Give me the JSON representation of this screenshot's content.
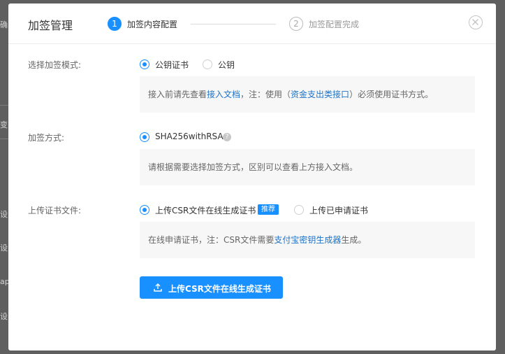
{
  "background": {
    "fragments": [
      "确",
      "变",
      "设",
      "设",
      "ap",
      "设"
    ]
  },
  "dialog": {
    "title": "加签管理",
    "steps": [
      {
        "number": "1",
        "label": "加签内容配置",
        "state": "active"
      },
      {
        "number": "2",
        "label": "加签配置完成",
        "state": "wait"
      }
    ]
  },
  "form": {
    "mode": {
      "label": "选择加签模式:",
      "options": [
        {
          "label": "公钥证书",
          "checked": true
        },
        {
          "label": "公钥",
          "checked": false
        }
      ],
      "hint": {
        "t1": "接入前请先查看",
        "link1": "接入文档",
        "t2": "，注：使用（",
        "link2": "资金支出类接口",
        "t3": "）必须使用证书方式。"
      }
    },
    "method": {
      "label": "加签方式:",
      "option": "SHA256withRSA",
      "help": "?",
      "hint": "请根据需要选择加签方式，区别可以查看上方接入文档。"
    },
    "cert": {
      "label": "上传证书文件:",
      "options": [
        {
          "label": "上传CSR文件在线生成证书",
          "checked": true,
          "badge": "推荐"
        },
        {
          "label": "上传已申请证书",
          "checked": false
        }
      ],
      "hint": {
        "t1": "在线申请证书，注：CSR文件需要",
        "link": "支付宝密钥生成器",
        "t2": "生成。"
      }
    },
    "upload_button": "上传CSR文件在线生成证书"
  },
  "colors": {
    "primary": "#1890ff",
    "link": "#1d73c9",
    "hint_bg": "#f7f7f7"
  }
}
